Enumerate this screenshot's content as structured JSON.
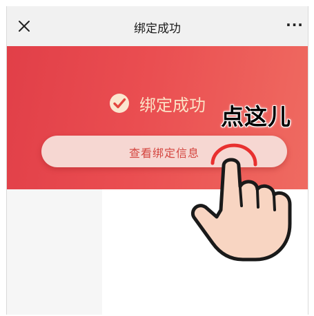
{
  "navbar": {
    "title": "绑定成功",
    "close_icon": "close-icon",
    "more_label": "···"
  },
  "banner": {
    "success_text": "绑定成功",
    "success_icon": "check-circle-icon",
    "button_label": "查看绑定信息",
    "gradient_colors": [
      "#e13f48",
      "#ef6b61"
    ],
    "success_text_color": "#fbe2c6",
    "button_color": "#f6d7d2"
  },
  "annotation": {
    "text": "点这儿",
    "hand_icon": "pointing-hand-icon",
    "tap_ring_color": "#e8302f"
  }
}
